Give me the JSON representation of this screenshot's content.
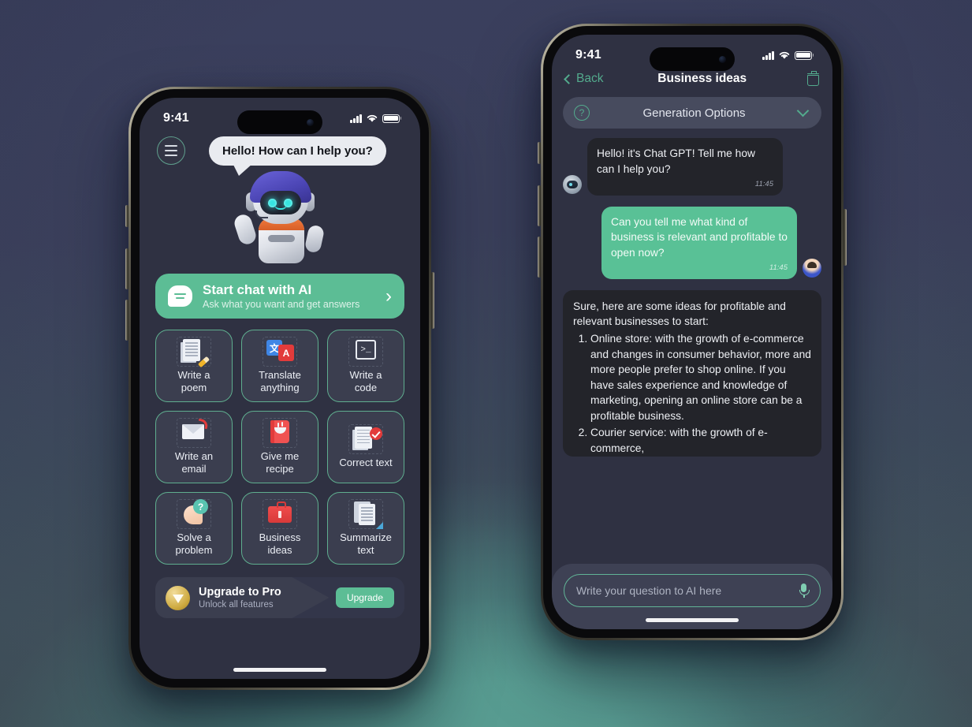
{
  "background": {
    "top_color": "#3a3d5c",
    "bottom_glow_color": "#5ea79a"
  },
  "left_phone": {
    "status_bar": {
      "time": "9:41",
      "signal_icon": "cellular-signal-icon",
      "wifi_icon": "wifi-icon",
      "battery_icon": "battery-full-icon"
    },
    "menu_button": {
      "icon": "hamburger-menu-icon"
    },
    "speech_bubble": {
      "text": "Hello! How can I help you?"
    },
    "mascot": {
      "name": "ai-robot-mascot"
    },
    "cta": {
      "icon": "chat-bubble-icon",
      "title": "Start chat with AI",
      "subtitle": "Ask what you want and get answers",
      "chevron": "›"
    },
    "cards": [
      {
        "id": "write-a-poem",
        "label": "Write a\npoem",
        "icon": "document-pencil-icon"
      },
      {
        "id": "translate",
        "label": "Translate\nanything",
        "icon": "translate-icon",
        "glyph_a": "文",
        "glyph_b": "A"
      },
      {
        "id": "write-a-code",
        "label": "Write a\ncode",
        "icon": "terminal-icon",
        "glyph": ">_"
      },
      {
        "id": "write-an-email",
        "label": "Write an\nemail",
        "icon": "envelope-icon"
      },
      {
        "id": "give-me-recipe",
        "label": "Give me\nrecipe",
        "icon": "recipe-book-icon"
      },
      {
        "id": "correct-text",
        "label": "Correct text",
        "icon": "document-check-icon"
      },
      {
        "id": "solve-a-problem",
        "label": "Solve a\nproblem",
        "icon": "head-question-icon",
        "glyph": "?"
      },
      {
        "id": "business-ideas",
        "label": "Business\nideas",
        "icon": "briefcase-icon"
      },
      {
        "id": "summarize-text",
        "label": "Summarize\ntext",
        "icon": "documents-stack-icon"
      }
    ],
    "upgrade_banner": {
      "icon": "diamond-gem-icon",
      "title": "Upgrade to Pro",
      "subtitle": "Unlock all features",
      "button_label": "Upgrade"
    }
  },
  "right_phone": {
    "status_bar": {
      "time": "9:41",
      "signal_icon": "cellular-signal-icon",
      "wifi_icon": "wifi-icon",
      "battery_icon": "battery-full-icon"
    },
    "nav": {
      "back_label": "Back",
      "back_icon": "chevron-left-icon",
      "title": "Business ideas",
      "delete_icon": "trash-icon"
    },
    "generation_options": {
      "help_icon": "question-mark-circle-icon",
      "label": "Generation Options",
      "chevron_icon": "chevron-down-icon"
    },
    "messages": [
      {
        "sender": "bot",
        "avatar": "bot-avatar",
        "text": "Hello! it's Chat GPT! Tell me how can I help you?",
        "time": "11:45"
      },
      {
        "sender": "user",
        "avatar": "user-avatar",
        "text": "Can you tell me what kind of business is relevant and profitable to open now?",
        "time": "11:45"
      }
    ],
    "long_message": {
      "sender": "bot",
      "intro": "Sure, here are some ideas for profitable and relevant businesses to start:",
      "items": [
        "Online store: with the growth of e-commerce and changes in consumer behavior, more and more people prefer to shop online. If you have sales experience and knowledge of marketing, opening an online store can be a profitable business.",
        "Courier service: with the growth of e-commerce,"
      ]
    },
    "input": {
      "placeholder": "Write your question to AI here",
      "value": "",
      "mic_icon": "microphone-icon"
    }
  }
}
